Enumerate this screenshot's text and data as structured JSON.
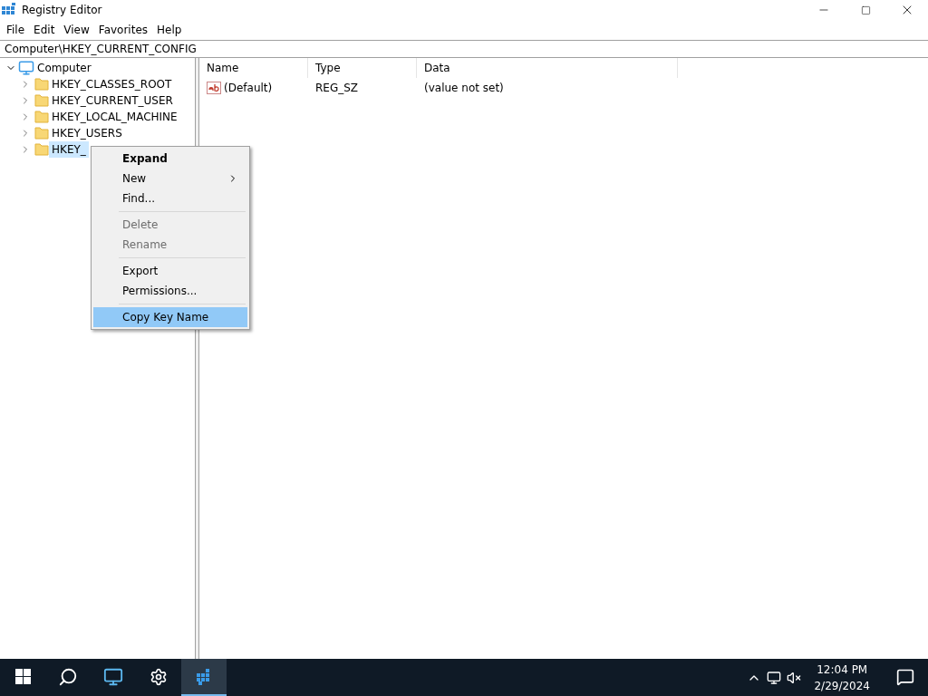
{
  "window": {
    "title": "Registry Editor"
  },
  "menu_bar": [
    "File",
    "Edit",
    "View",
    "Favorites",
    "Help"
  ],
  "address": "Computer\\HKEY_CURRENT_CONFIG",
  "tree": {
    "label": "Computer",
    "expanded": true,
    "selected": false,
    "children": [
      {
        "label": "HKEY_CLASSES_ROOT",
        "expanded": false,
        "selected": false
      },
      {
        "label": "HKEY_CURRENT_USER",
        "expanded": false,
        "selected": false
      },
      {
        "label": "HKEY_LOCAL_MACHINE",
        "expanded": false,
        "selected": false
      },
      {
        "label": "HKEY_USERS",
        "expanded": false,
        "selected": false
      },
      {
        "label": "HKEY_",
        "expanded": false,
        "selected": true
      }
    ]
  },
  "table": {
    "columns": [
      "Name",
      "Type",
      "Data"
    ],
    "rows": [
      {
        "name": "(Default)",
        "type": "REG_SZ",
        "data": "(value not set)"
      }
    ]
  },
  "context_menu": [
    {
      "kind": "item",
      "label": "Expand",
      "default": true,
      "disabled": false,
      "submenu": false,
      "selected": false
    },
    {
      "kind": "item",
      "label": "New",
      "default": false,
      "disabled": false,
      "submenu": true,
      "selected": false
    },
    {
      "kind": "item",
      "label": "Find...",
      "default": false,
      "disabled": false,
      "submenu": false,
      "selected": false
    },
    {
      "kind": "separator"
    },
    {
      "kind": "item",
      "label": "Delete",
      "default": false,
      "disabled": true,
      "submenu": false,
      "selected": false
    },
    {
      "kind": "item",
      "label": "Rename",
      "default": false,
      "disabled": true,
      "submenu": false,
      "selected": false
    },
    {
      "kind": "separator"
    },
    {
      "kind": "item",
      "label": "Export",
      "default": false,
      "disabled": false,
      "submenu": false,
      "selected": false
    },
    {
      "kind": "item",
      "label": "Permissions...",
      "default": false,
      "disabled": false,
      "submenu": false,
      "selected": false
    },
    {
      "kind": "separator"
    },
    {
      "kind": "item",
      "label": "Copy Key Name",
      "default": false,
      "disabled": false,
      "submenu": false,
      "selected": true
    }
  ],
  "taskbar": {
    "apps": [
      {
        "kind": "start",
        "selected": false
      },
      {
        "kind": "search",
        "selected": false
      },
      {
        "kind": "computer",
        "selected": false
      },
      {
        "kind": "settings",
        "selected": false
      },
      {
        "kind": "registry",
        "selected": true
      }
    ],
    "time": "12:04 PM",
    "date": "2/29/2024"
  }
}
